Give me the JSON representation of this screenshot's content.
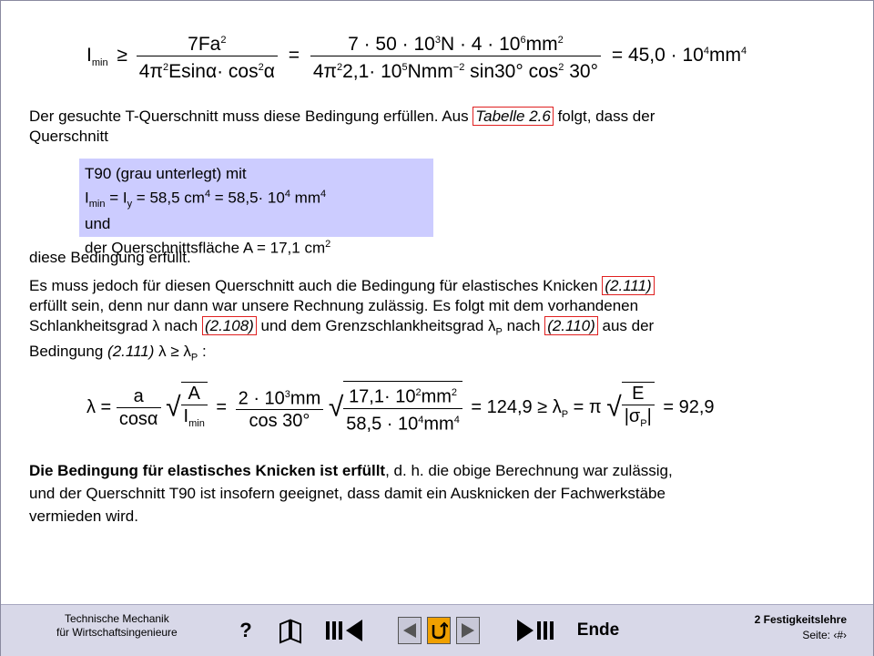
{
  "eq1": {
    "lhs": "I",
    "lhs_sub": "min",
    "rel": "≥",
    "f1_num": "7Fa",
    "f1_num_sup": "2",
    "f1_den": "4π",
    "f1_den_sup": "2",
    "f1_den2": "Esinα· cos",
    "f1_den2_sup": "2",
    "f1_den3": "α",
    "eq": "=",
    "f2_num": "7 · 50 · 10",
    "f2_num_sup1": "3",
    "f2_num2": "N · 4 · 10",
    "f2_num_sup2": "6",
    "f2_num3": "mm",
    "f2_num_sup3": "2",
    "f2_den": "4π",
    "f2_den_sup": "2",
    "f2_den2": "2,1· 10",
    "f2_den_sup2": "5",
    "f2_den3": "Nmm",
    "f2_den_sup3": "−2",
    "f2_den4": " sin30° cos",
    "f2_den_sup4": "2",
    "f2_den5": " 30°",
    "result": "= 45,0 · 10",
    "result_sup": "4",
    "result_unit": "mm",
    "result_unit_sup": "4"
  },
  "p1": {
    "line1_a": "Der gesuchte T-Querschnitt muss diese Bedingung erfüllen. Aus ",
    "ref": "Tabelle 2.6",
    "line1_b": " folgt, dass der",
    "line2": "Querschnitt"
  },
  "box": {
    "l1": "T90 (grau unterlegt) mit",
    "l2_a": "I",
    "l2_sub1": "min",
    "l2_b": " = I",
    "l2_sub2": "y",
    "l2_c": " = 58,5 cm",
    "l2_sup1": "4",
    "l2_d": " = 58,5· 10",
    "l2_sup2": "4",
    "l2_e": " mm",
    "l2_sup3": "4",
    "l3": "und",
    "l4": "der Querschnittsfläche A = 17,1 cm",
    "l4_sup": "2"
  },
  "p2": "diese Bedingung erfüllt.",
  "p3": {
    "l1_a": "Es muss jedoch für diesen Querschnitt auch die Bedingung für elastisches Knicken ",
    "ref1": "(2.111)",
    "l2": "erfüllt sein, denn nur dann war unsere Rechnung zulässig. Es folgt mit dem vorhandenen",
    "l3_a": "Schlankheitsgrad λ nach ",
    "ref2": "(2.108)",
    "l3_b": " und dem Grenzschlankheitsgrad λ",
    "l3_sub": "P",
    "l3_c": " nach ",
    "ref3": "(2.110)",
    "l3_d": " aus der",
    "l4_a": "Bedingung ",
    "l4_ref": "(2.111)",
    "l4_b": " λ ≥ λ",
    "l4_sub": "P",
    "l4_c": " :"
  },
  "eq2": {
    "lambda": "λ =",
    "f1_num": "a",
    "f1_den": "cosα",
    "sqrt1_num": "A",
    "sqrt1_den": "I",
    "sqrt1_den_sub": "min",
    "eq1": "=",
    "f2_num": "2 · 10",
    "f2_num_sup": "3",
    "f2_num2": "mm",
    "f2_den": "cos 30°",
    "sqrt2_num": "17,1· 10",
    "sqrt2_num_sup": "2",
    "sqrt2_num2": "mm",
    "sqrt2_num_sup2": "2",
    "sqrt2_den": "58,5 · 10",
    "sqrt2_den_sup": "4",
    "sqrt2_den2": "mm",
    "sqrt2_den_sup2": "4",
    "mid": "= 124,9 ≥ λ",
    "mid_sub": "P",
    "mid2": " = π",
    "sqrt3_num": "E",
    "sqrt3_den": "|σ",
    "sqrt3_den_sub": "P",
    "sqrt3_den2": "|",
    "end": "= 92,9"
  },
  "p4": {
    "bold": "Die Bedingung für elastisches Knicken ist erfüllt",
    "l1": ", d. h. die obige Berechnung war zulässig,",
    "l2": "und der Querschnitt T90 ist insofern geeignet, dass damit ein Ausknicken der Fachwerkstäbe",
    "l3": "vermieden wird."
  },
  "footer": {
    "left1": "Technische Mechanik",
    "left2": "für Wirtschaftsingenieure",
    "help": "?",
    "ende": "Ende",
    "right1": "2  Festigkeitslehre",
    "right2": "Seite:  ‹#›"
  }
}
